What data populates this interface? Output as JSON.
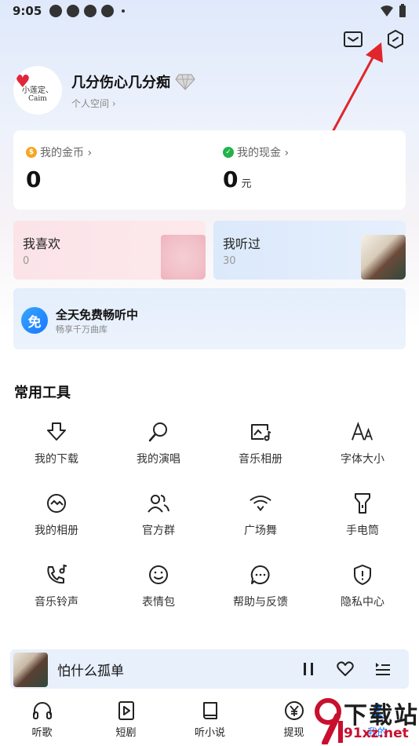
{
  "status_bar": {
    "time": "9:05"
  },
  "profile": {
    "avatar_line1": "小莲定、",
    "avatar_line2": "Caim",
    "username": "几分伤心几分痴",
    "sub_link": "个人空间 ›"
  },
  "money": {
    "coins_label": "我的金币 ›",
    "coins_value": "0",
    "cash_label": "我的现金 ›",
    "cash_value": "0",
    "cash_unit": "元",
    "coin_icon_glyph": "$",
    "cash_icon_glyph": "✓"
  },
  "tiles": {
    "like": {
      "title": "我喜欢",
      "count": "0"
    },
    "heard": {
      "title": "我听过",
      "count": "30"
    }
  },
  "free_banner": {
    "icon_char": "免",
    "title": "全天免费畅听中",
    "subtitle": "畅享千万曲库"
  },
  "tools": {
    "section_title": "常用工具",
    "items": [
      {
        "label": "我的下载",
        "icon": "download-icon"
      },
      {
        "label": "我的演唱",
        "icon": "microphone-icon"
      },
      {
        "label": "音乐相册",
        "icon": "music-album-icon"
      },
      {
        "label": "字体大小",
        "icon": "font-size-icon"
      },
      {
        "label": "我的相册",
        "icon": "photo-album-icon"
      },
      {
        "label": "官方群",
        "icon": "group-icon"
      },
      {
        "label": "广场舞",
        "icon": "square-dance-icon"
      },
      {
        "label": "手电筒",
        "icon": "flashlight-icon"
      },
      {
        "label": "音乐铃声",
        "icon": "ringtone-icon"
      },
      {
        "label": "表情包",
        "icon": "emoji-icon"
      },
      {
        "label": "帮助与反馈",
        "icon": "help-feedback-icon"
      },
      {
        "label": "隐私中心",
        "icon": "privacy-icon"
      }
    ]
  },
  "player": {
    "song_title": "怕什么孤单"
  },
  "bottom_nav": {
    "items": [
      {
        "label": "听歌",
        "icon": "headphones-icon"
      },
      {
        "label": "短剧",
        "icon": "short-drama-icon"
      },
      {
        "label": "听小说",
        "icon": "book-icon"
      },
      {
        "label": "提现",
        "icon": "withdraw-icon"
      },
      {
        "label": "我的",
        "icon": "profile-icon"
      }
    ]
  },
  "watermark": {
    "line1": "下载站",
    "line2": "91xz.net"
  },
  "colors": {
    "accent": "#1677ff",
    "annotation": "#e0262b",
    "coin": "#f5a623",
    "cash": "#21b34a"
  }
}
